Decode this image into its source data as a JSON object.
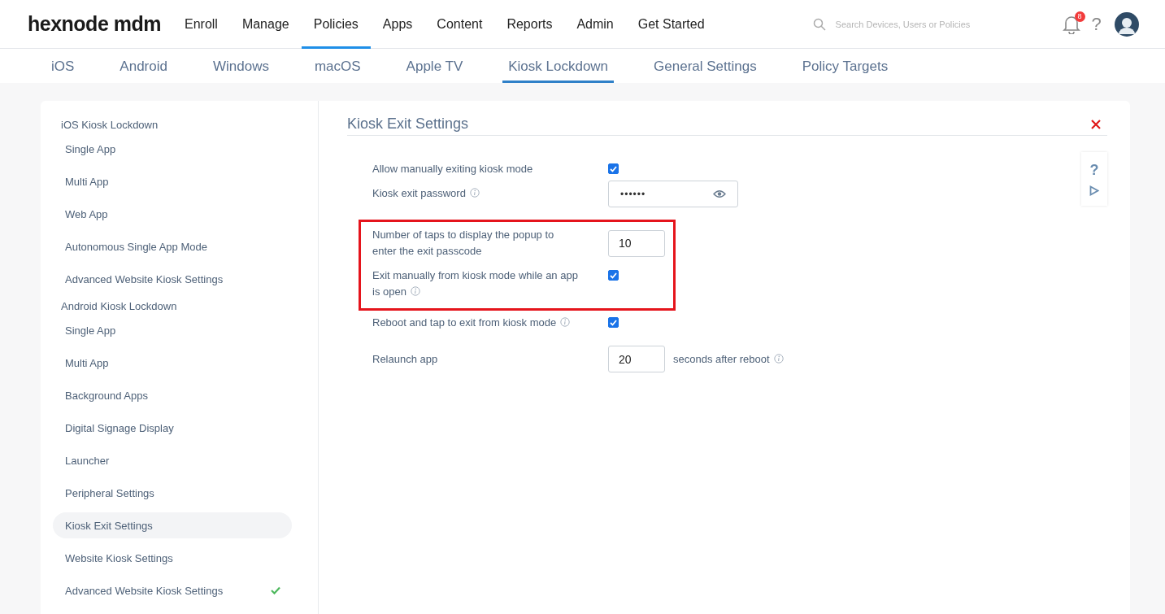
{
  "logo": "hexnode mdm",
  "nav": [
    {
      "label": "Enroll",
      "selected": false
    },
    {
      "label": "Manage",
      "selected": false
    },
    {
      "label": "Policies",
      "selected": true
    },
    {
      "label": "Apps",
      "selected": false
    },
    {
      "label": "Content",
      "selected": false
    },
    {
      "label": "Reports",
      "selected": false
    },
    {
      "label": "Admin",
      "selected": false
    },
    {
      "label": "Get Started",
      "selected": false
    }
  ],
  "search": {
    "placeholder": "Search Devices, Users or Policies"
  },
  "notifications": {
    "count": "8"
  },
  "help": "?",
  "tabs": [
    {
      "label": "iOS",
      "selected": false
    },
    {
      "label": "Android",
      "selected": false
    },
    {
      "label": "Windows",
      "selected": false
    },
    {
      "label": "macOS",
      "selected": false
    },
    {
      "label": "Apple TV",
      "selected": false
    },
    {
      "label": "Kiosk Lockdown",
      "selected": true
    },
    {
      "label": "General Settings",
      "selected": false
    },
    {
      "label": "Policy Targets",
      "selected": false
    }
  ],
  "sidebar": {
    "groups": [
      {
        "title": "iOS Kiosk Lockdown",
        "items": [
          {
            "label": "Single App",
            "selected": false,
            "configured": false
          },
          {
            "label": "Multi App",
            "selected": false,
            "configured": false
          },
          {
            "label": "Web App",
            "selected": false,
            "configured": false
          },
          {
            "label": "Autonomous Single App Mode",
            "selected": false,
            "configured": false
          },
          {
            "label": "Advanced Website Kiosk Settings",
            "selected": false,
            "configured": false
          }
        ]
      },
      {
        "title": "Android Kiosk Lockdown",
        "items": [
          {
            "label": "Single App",
            "selected": false,
            "configured": false
          },
          {
            "label": "Multi App",
            "selected": false,
            "configured": false
          },
          {
            "label": "Background Apps",
            "selected": false,
            "configured": false
          },
          {
            "label": "Digital Signage Display",
            "selected": false,
            "configured": false
          },
          {
            "label": "Launcher",
            "selected": false,
            "configured": false
          },
          {
            "label": "Peripheral Settings",
            "selected": false,
            "configured": false
          },
          {
            "label": "Kiosk Exit Settings",
            "selected": true,
            "configured": false
          },
          {
            "label": "Website Kiosk Settings",
            "selected": false,
            "configured": false
          },
          {
            "label": "Advanced Website Kiosk Settings",
            "selected": false,
            "configured": true
          }
        ]
      }
    ]
  },
  "panel": {
    "title": "Kiosk Exit Settings",
    "side_help": "?",
    "sections": [
      {
        "highlighted": false,
        "rows": [
          {
            "kind": "checkbox",
            "label": "Allow manually exiting kiosk mode",
            "info": false,
            "checked": true
          },
          {
            "kind": "password",
            "label": "Kiosk exit password",
            "info": true,
            "value": "••••••"
          }
        ]
      },
      {
        "highlighted": true,
        "rows": [
          {
            "kind": "number",
            "label": "Number of taps to display the popup to enter the exit passcode",
            "info": false,
            "value": "10"
          },
          {
            "kind": "checkbox",
            "label": "Exit manually from kiosk mode while an app is open",
            "info": true,
            "checked": true
          }
        ]
      },
      {
        "highlighted": false,
        "rows": [
          {
            "kind": "checkbox",
            "label": "Reboot and tap to exit from kiosk mode",
            "info": true,
            "checked": true
          },
          {
            "kind": "number",
            "label": "Relaunch app",
            "info": false,
            "value": "20",
            "suffix": "seconds after reboot",
            "suffix_info": true
          }
        ]
      }
    ]
  }
}
